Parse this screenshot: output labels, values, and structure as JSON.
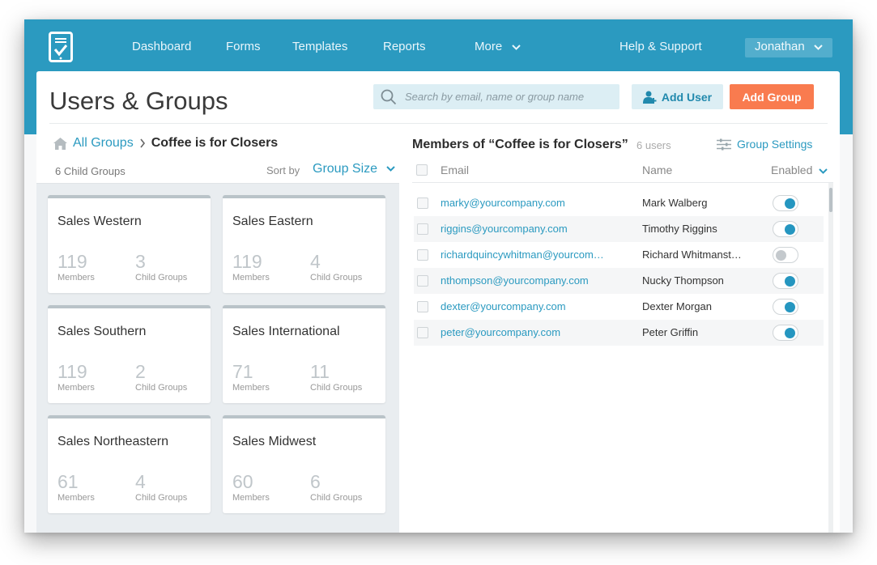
{
  "nav": {
    "items": [
      {
        "label": "Dashboard"
      },
      {
        "label": "Forms"
      },
      {
        "label": "Templates"
      },
      {
        "label": "Reports"
      },
      {
        "label": "More"
      }
    ],
    "help": "Help & Support",
    "user": "Jonathan"
  },
  "header": {
    "title": "Users & Groups",
    "search_placeholder": "Search by email, name or group name",
    "add_user": "Add User",
    "add_group": "Add Group"
  },
  "breadcrumb": {
    "root": "All Groups",
    "current": "Coffee is for Closers"
  },
  "groups_panel": {
    "child_count": "6 Child Groups",
    "sort_label": "Sort by",
    "sort_value": "Group Size",
    "members_label": "Members",
    "child_groups_label": "Child Groups",
    "groups": [
      {
        "name": "Sales Western",
        "members": "119",
        "child_groups": "3"
      },
      {
        "name": "Sales Eastern",
        "members": "119",
        "child_groups": "4"
      },
      {
        "name": "Sales Southern",
        "members": "119",
        "child_groups": "2"
      },
      {
        "name": "Sales International",
        "members": "71",
        "child_groups": "11"
      },
      {
        "name": "Sales Northeastern",
        "members": "61",
        "child_groups": "4"
      },
      {
        "name": "Sales Midwest",
        "members": "60",
        "child_groups": "6"
      }
    ]
  },
  "members_panel": {
    "title": "Members of “Coffee is for Closers”",
    "count": "6 users",
    "settings": "Group Settings",
    "columns": {
      "email": "Email",
      "name": "Name",
      "enabled": "Enabled"
    },
    "rows": [
      {
        "email": "marky@yourcompany.com",
        "name": "Mark Walberg",
        "enabled": true
      },
      {
        "email": "riggins@yourcompany.com",
        "name": "Timothy Riggins",
        "enabled": true
      },
      {
        "email": "richardquincywhitman@yourcom…",
        "name": "Richard Whitmanst…",
        "enabled": false
      },
      {
        "email": "nthompson@yourcompany.com",
        "name": "Nucky Thompson",
        "enabled": true
      },
      {
        "email": "dexter@yourcompany.com",
        "name": "Dexter Morgan",
        "enabled": true
      },
      {
        "email": "peter@yourcompany.com",
        "name": "Peter Griffin",
        "enabled": true
      }
    ]
  },
  "colors": {
    "brand": "#2b9ac0",
    "accent": "#f97b4f",
    "toggle_on": "#2596c0",
    "toggle_off": "#c4c9cd"
  }
}
